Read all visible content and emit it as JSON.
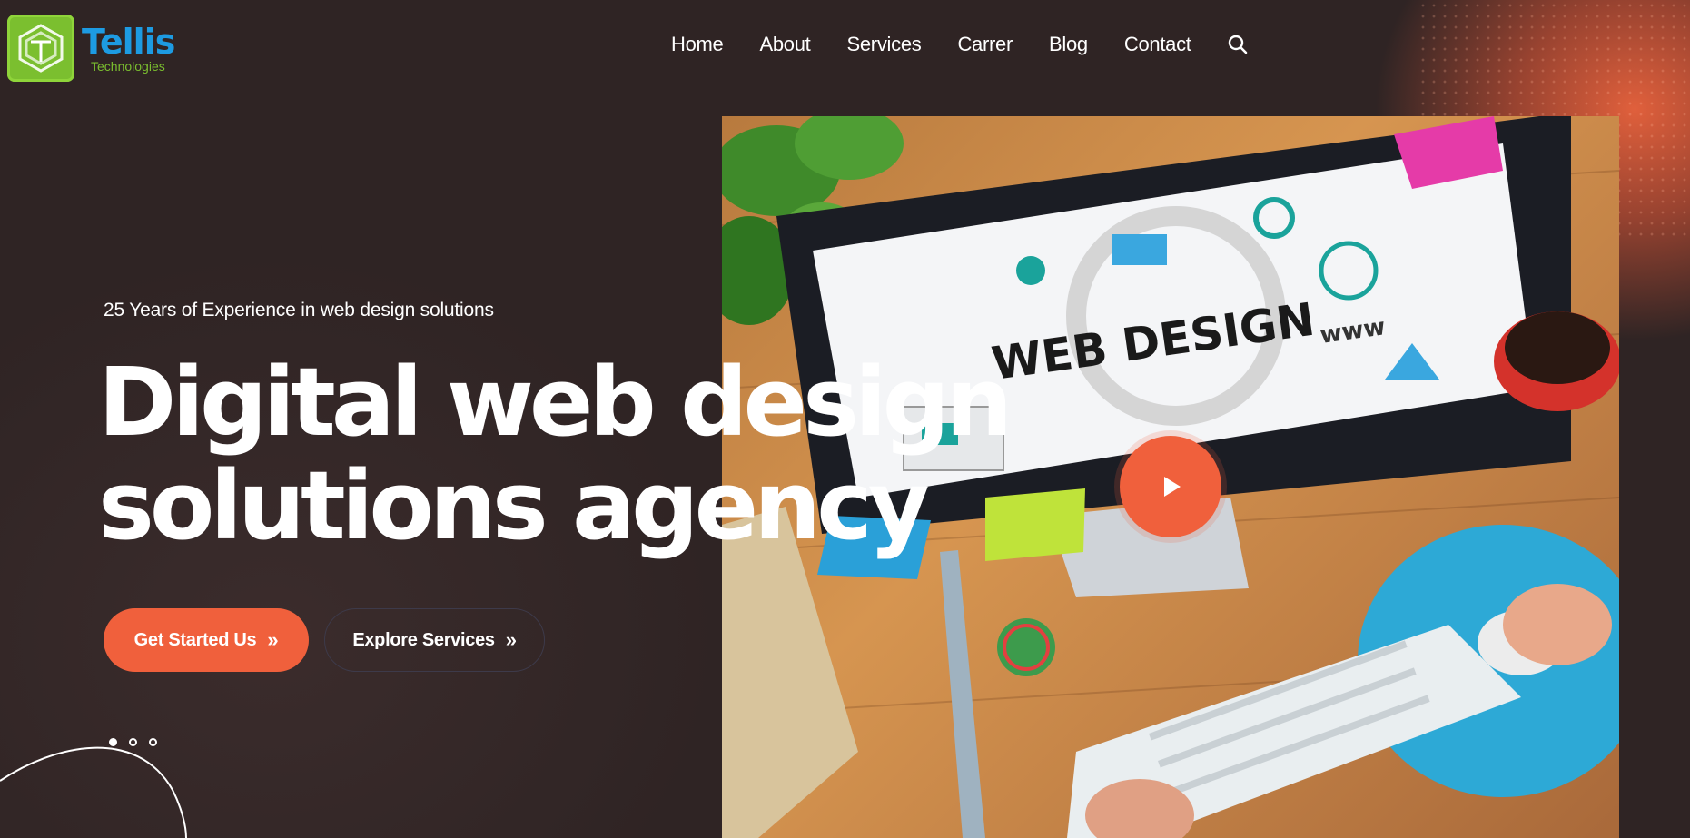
{
  "brand": {
    "name": "Tellis",
    "tagline": "Technologies"
  },
  "nav": {
    "items": [
      {
        "label": "Home"
      },
      {
        "label": "About"
      },
      {
        "label": "Services"
      },
      {
        "label": "Carrer"
      },
      {
        "label": "Blog"
      },
      {
        "label": "Contact"
      }
    ],
    "search_icon": "search-icon"
  },
  "hero": {
    "eyebrow": "25 Years of Experience in web design solutions",
    "headline_line1": "Digital web design",
    "headline_line2": "solutions agency",
    "primary_button": "Get Started Us",
    "secondary_button": "Explore Services",
    "image_text": "WEB DESIGN",
    "image_text_www": "www",
    "slider": {
      "count": 3,
      "active": 1
    }
  },
  "colors": {
    "accent": "#f0603c",
    "background": "#2e2323",
    "brand_blue": "#1d9be2",
    "brand_green": "#7bbf2f"
  }
}
